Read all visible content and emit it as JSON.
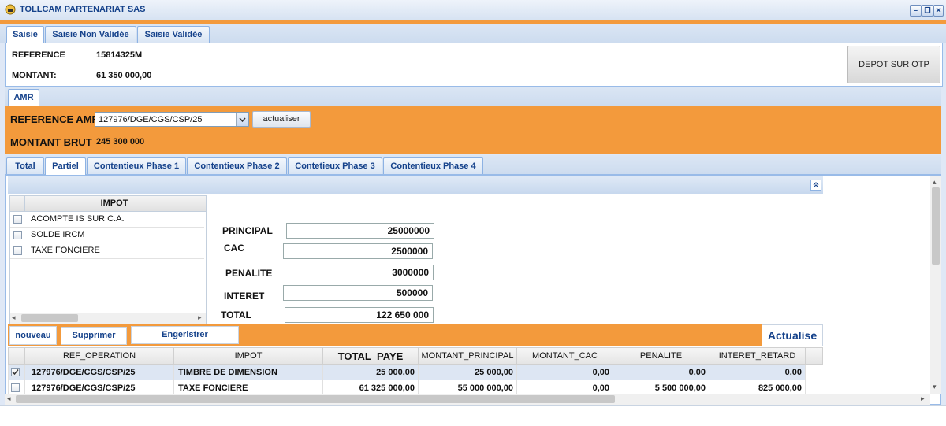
{
  "window": {
    "title": "TOLLCAM PARTENARIAT SAS"
  },
  "top_tabs": [
    "Saisie",
    "Saisie Non Validée",
    "Saisie Validée"
  ],
  "header": {
    "reference_label": "REFERENCE",
    "reference_value": "15814325M",
    "montant_label": "MONTANT:",
    "montant_value": "61 350 000,00",
    "depot_button": "DEPOT SUR OTP"
  },
  "amr_tab": "AMR",
  "amr": {
    "reference_label": "REFERENCE AMR",
    "reference_value": "127976/DGE/CGS/CSP/25",
    "actualiser_button": "actualiser",
    "montant_brut_label": "MONTANT BRUT",
    "montant_brut_value": "245 300 000"
  },
  "phase_tabs": [
    "Total",
    "Partiel",
    "Contentieux Phase 1",
    "Contentieux Phase 2",
    "Contetieux Phase 3",
    "Contentieux Phase 4"
  ],
  "impot_list": {
    "header": "IMPOT",
    "items": [
      "ACOMPTE IS SUR C.A.",
      "SOLDE IRCM",
      "TAXE FONCIERE"
    ]
  },
  "amounts": {
    "principal_label": "PRINCIPAL",
    "principal_value": "25000000",
    "cac_label": "CAC",
    "cac_value": "2500000",
    "penalite_label": "PENALITE",
    "penalite_value": "3000000",
    "interet_label": "INTERET",
    "interet_value": "500000",
    "total_label": "TOTAL",
    "total_value": "122 650 000"
  },
  "actions": {
    "nouveau": "nouveau",
    "supprimer": "Supprimer",
    "engeristrer": "Engeristrer",
    "actualise": "Actualise"
  },
  "grid": {
    "columns": [
      "REF_OPERATION",
      "IMPOT",
      "TOTAL_PAYE",
      "MONTANT_PRINCIPAL",
      "MONTANT_CAC",
      "PENALITE",
      "INTERET_RETARD"
    ],
    "rows": [
      {
        "checked": true,
        "cells": [
          "127976/DGE/CGS/CSP/25",
          "TIMBRE DE DIMENSION",
          "25 000,00",
          "25 000,00",
          "0,00",
          "0,00",
          "0,00"
        ]
      },
      {
        "checked": false,
        "cells": [
          "127976/DGE/CGS/CSP/25",
          "TAXE FONCIERE",
          "61 325 000,00",
          "55 000 000,00",
          "0,00",
          "5 500 000,00",
          "825 000,00"
        ]
      }
    ]
  },
  "colors": {
    "accent_orange": "#f39a3c",
    "title_blue": "#15428b",
    "border_blue": "#99bbe8"
  }
}
